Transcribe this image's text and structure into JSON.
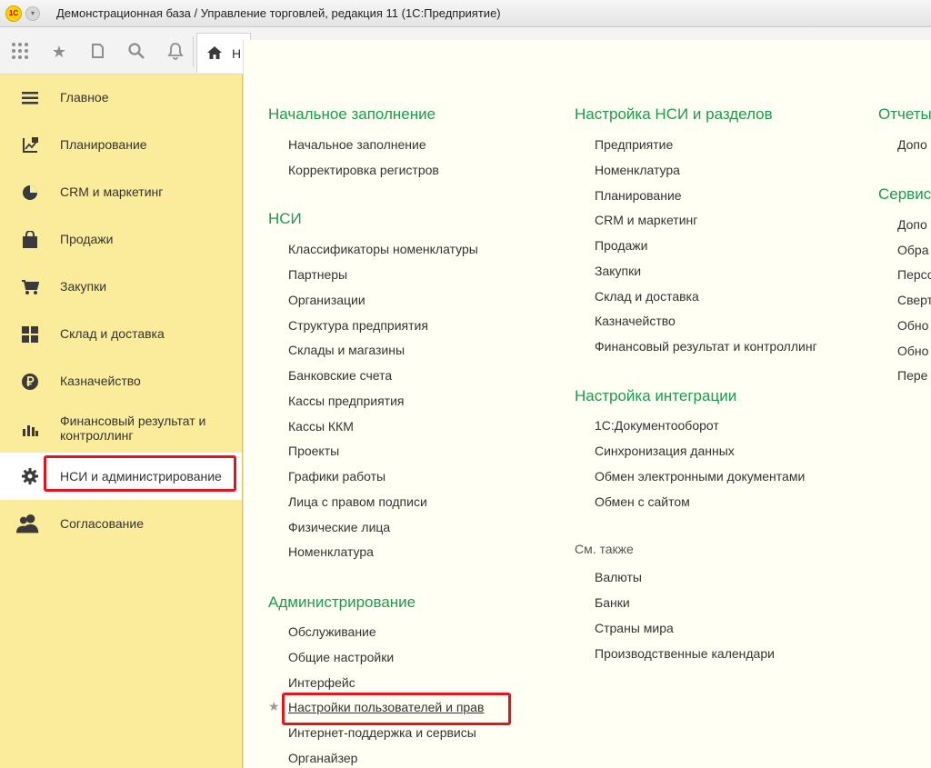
{
  "window": {
    "logo_text": "1С",
    "title": "Демонстрационная база / Управление торговлей, редакция 11  (1С:Предприятие)"
  },
  "toolbar": {
    "icons": [
      "apps-grid-icon",
      "star-icon",
      "history-icon",
      "search-icon",
      "bell-icon"
    ],
    "home_tab_label": "Н"
  },
  "sidebar": {
    "items": [
      {
        "label": "Главное",
        "icon": "menu-lines-icon"
      },
      {
        "label": "Планирование",
        "icon": "planning-chart-icon"
      },
      {
        "label": "CRM и маркетинг",
        "icon": "pie-chart-icon"
      },
      {
        "label": "Продажи",
        "icon": "shopping-bag-icon"
      },
      {
        "label": "Закупки",
        "icon": "cart-icon"
      },
      {
        "label": "Склад и доставка",
        "icon": "warehouse-grid-icon"
      },
      {
        "label": "Казначейство",
        "icon": "ruble-coin-icon"
      },
      {
        "label": "Финансовый результат и контроллинг",
        "icon": "bar-chart-icon"
      },
      {
        "label": "НСИ и администрирование",
        "icon": "gear-icon"
      },
      {
        "label": "Согласование",
        "icon": "users-icon"
      }
    ]
  },
  "panel": {
    "col1": {
      "sections": [
        {
          "title": "Начальное заполнение",
          "links": [
            "Начальное заполнение",
            "Корректировка регистров"
          ]
        },
        {
          "title": "НСИ",
          "links": [
            "Классификаторы номенклатуры",
            "Партнеры",
            "Организации",
            "Структура предприятия",
            "Склады и магазины",
            "Банковские счета",
            "Кассы предприятия",
            "Кассы ККМ",
            "Проекты",
            "Графики работы",
            "Лица с правом подписи",
            "Физические лица",
            "Номенклатура"
          ]
        },
        {
          "title": "Администрирование",
          "links": [
            "Обслуживание",
            "Общие настройки",
            "Интерфейс",
            "Настройки пользователей и прав",
            "Интернет-поддержка и сервисы",
            "Органайзер"
          ]
        }
      ]
    },
    "col2": {
      "sections": [
        {
          "title": "Настройка НСИ и разделов",
          "links": [
            "Предприятие",
            "Номенклатура",
            "Планирование",
            "CRM и маркетинг",
            "Продажи",
            "Закупки",
            "Склад и доставка",
            "Казначейство",
            "Финансовый результат и контроллинг"
          ]
        },
        {
          "title": "Настройка интеграции",
          "links": [
            "1С:Документооборот",
            "Синхронизация данных",
            "Обмен электронными документами",
            "Обмен с сайтом"
          ]
        }
      ],
      "see_also": {
        "title": "См. также",
        "links": [
          "Валюты",
          "Банки",
          "Страны мира",
          "Производственные календари"
        ]
      }
    },
    "col3": {
      "sections": [
        {
          "title": "Отчеты",
          "links": [
            "Допо"
          ]
        },
        {
          "title": "Сервис",
          "links": [
            "Допо",
            "Обра",
            "Персо",
            "Сверт",
            "Обно",
            "Обно",
            "Пере"
          ]
        }
      ]
    }
  },
  "colors": {
    "sidebar_bg": "#fbec9c",
    "section_title": "#1d9a4b",
    "highlight": "#e2141e",
    "panel_bg": "#fffff4"
  }
}
